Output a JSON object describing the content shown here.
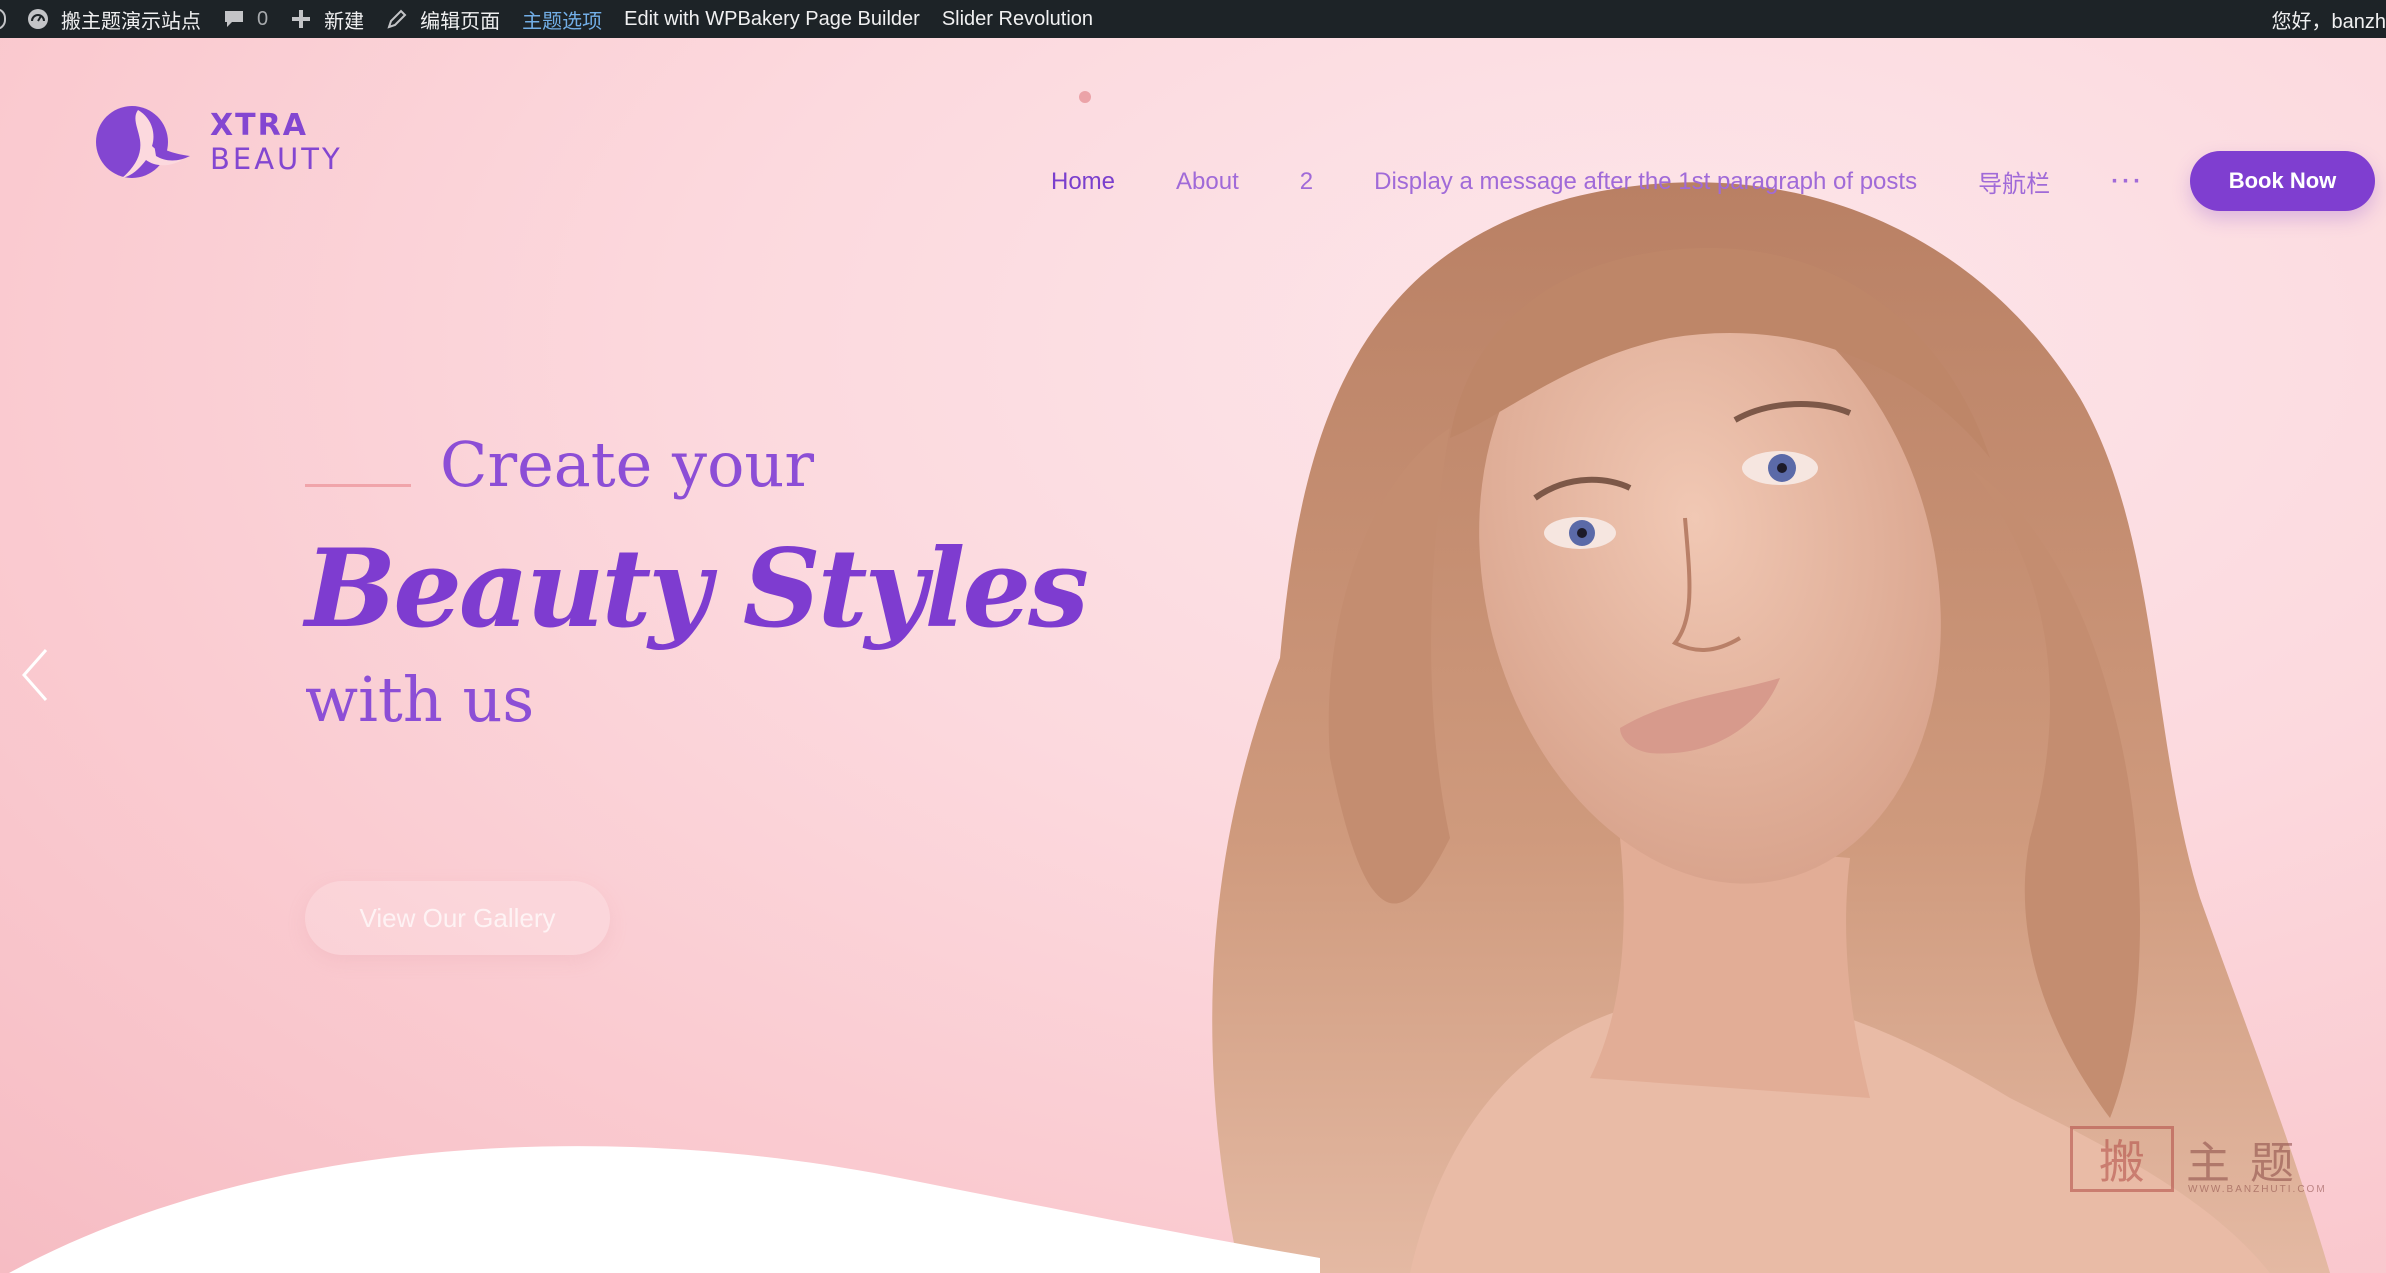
{
  "admin_bar": {
    "site_name": "搬主题演示站点",
    "comments_count": "0",
    "new_label": "新建",
    "edit_page_label": "编辑页面",
    "theme_options_label": "主题选项",
    "wpbakery_label": "Edit with WPBakery Page Builder",
    "slider_label": "Slider Revolution",
    "greeting": "您好，banzh"
  },
  "logo": {
    "line1": "XTRA",
    "line2": "BEAUTY"
  },
  "nav": {
    "items": [
      {
        "label": "Home",
        "current": true
      },
      {
        "label": "About"
      },
      {
        "label": "2"
      },
      {
        "label": "Display a message after the 1st paragraph of posts"
      },
      {
        "label": "导航栏"
      }
    ],
    "more_label": "···",
    "book_button": "Book Now"
  },
  "hero": {
    "line1": "Create your",
    "line2": "Beauty Styles",
    "line3": "with us",
    "gallery_button": "View Our Gallery"
  },
  "watermark": {
    "char": "搬",
    "text": "主题",
    "sub": "WWW.BANZHUTI.COM"
  },
  "colors": {
    "accent": "#7f3ed0",
    "nav_text": "#a06ad8",
    "admin_bar_bg": "#1d2327",
    "admin_active": "#72aee6",
    "hero_bg": "#fcd9de"
  }
}
